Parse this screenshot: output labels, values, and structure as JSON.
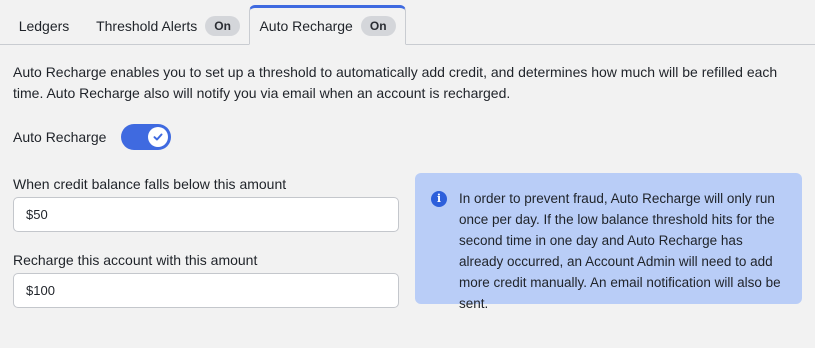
{
  "tabs": [
    {
      "label": "Ledgers"
    },
    {
      "label": "Threshold Alerts",
      "badge": "On"
    },
    {
      "label": "Auto Recharge",
      "badge": "On",
      "active": true
    }
  ],
  "description": "Auto Recharge enables you to set up a threshold to automatically add credit, and determines how much will be refilled each time. Auto Recharge also will notify you via email when an account is recharged.",
  "auto_recharge_toggle": {
    "label": "Auto Recharge",
    "enabled": true
  },
  "threshold_field": {
    "label": "When credit balance falls below this amount",
    "value": "$50"
  },
  "recharge_field": {
    "label": "Recharge this account with this amount",
    "value": "$100"
  },
  "info_box": {
    "icon": "info-icon",
    "text": "In order to prevent fraud, Auto Recharge will only run once per day. If the low balance threshold hits for the second time in one day and Auto Recharge has already occurred, an Account Admin will need to add more credit manually. An email notification will also be sent."
  },
  "colors": {
    "accent": "#3f6ae0",
    "info_bg": "#b9cdf7",
    "badge_bg": "#d4d6da"
  }
}
